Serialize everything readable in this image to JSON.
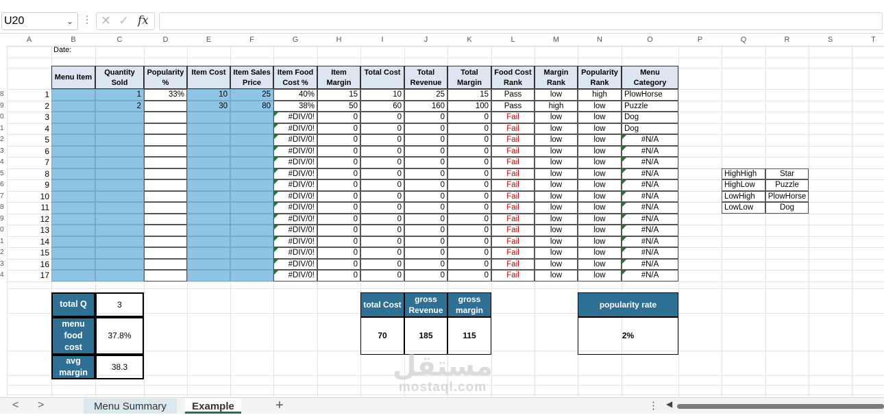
{
  "formula_bar": {
    "name_box": "U20",
    "icons": [
      "chevron-down-icon",
      "more-options-icon",
      "cancel-icon",
      "confirm-icon",
      "function-icon"
    ],
    "fx_label": "fx",
    "formula_value": ""
  },
  "columns": [
    "A",
    "B",
    "C",
    "D",
    "E",
    "F",
    "G",
    "H",
    "I",
    "J",
    "K",
    "L",
    "M",
    "N",
    "O",
    "P",
    "Q",
    "R",
    "S",
    "T"
  ],
  "headers": {
    "date": "Date:",
    "menu_item": "Menu Item",
    "quantity_sold": "Quantity Sold",
    "popularity": "Popularity %",
    "item_cost": "Item Cost",
    "item_sales_price": "Item Sales Price",
    "item_food_cost": "Item Food Cost %",
    "item_margin": "Item Margin",
    "total_cost": "Total Cost",
    "total_revenue": "Total Revenue",
    "total_margin": "Total Margin",
    "food_cost_rank": "Food Cost Rank",
    "margin_rank": "Margin Rank",
    "popularity_rank": "Popularity Rank",
    "menu_category": "Menu Category"
  },
  "rows": [
    {
      "n": "1",
      "qty": "1",
      "pop": "33%",
      "cost": "10",
      "price": "25",
      "fc": "40%",
      "margin": "15",
      "tcost": "10",
      "trev": "25",
      "tmargin": "15",
      "fcrank": "Pass",
      "mrank": "low",
      "prank": "high",
      "cat": "PlowHorse"
    },
    {
      "n": "2",
      "qty": "2",
      "pop": "",
      "cost": "30",
      "price": "80",
      "fc": "38%",
      "margin": "50",
      "tcost": "60",
      "trev": "160",
      "tmargin": "100",
      "fcrank": "Pass",
      "mrank": "high",
      "prank": "low",
      "cat": "Puzzle"
    },
    {
      "n": "3",
      "qty": "",
      "pop": "",
      "cost": "",
      "price": "",
      "fc": "#DIV/0!",
      "margin": "0",
      "tcost": "0",
      "trev": "0",
      "tmargin": "0",
      "fcrank": "Fail",
      "mrank": "low",
      "prank": "low",
      "cat": "Dog"
    },
    {
      "n": "4",
      "qty": "",
      "pop": "",
      "cost": "",
      "price": "",
      "fc": "#DIV/0!",
      "margin": "0",
      "tcost": "0",
      "trev": "0",
      "tmargin": "0",
      "fcrank": "Fail",
      "mrank": "low",
      "prank": "low",
      "cat": "Dog"
    },
    {
      "n": "5",
      "qty": "",
      "pop": "",
      "cost": "",
      "price": "",
      "fc": "#DIV/0!",
      "margin": "0",
      "tcost": "0",
      "trev": "0",
      "tmargin": "0",
      "fcrank": "Fail",
      "mrank": "low",
      "prank": "low",
      "cat": "#N/A"
    },
    {
      "n": "6",
      "qty": "",
      "pop": "",
      "cost": "",
      "price": "",
      "fc": "#DIV/0!",
      "margin": "0",
      "tcost": "0",
      "trev": "0",
      "tmargin": "0",
      "fcrank": "Fail",
      "mrank": "low",
      "prank": "low",
      "cat": "#N/A"
    },
    {
      "n": "7",
      "qty": "",
      "pop": "",
      "cost": "",
      "price": "",
      "fc": "#DIV/0!",
      "margin": "0",
      "tcost": "0",
      "trev": "0",
      "tmargin": "0",
      "fcrank": "Fail",
      "mrank": "low",
      "prank": "low",
      "cat": "#N/A"
    },
    {
      "n": "8",
      "qty": "",
      "pop": "",
      "cost": "",
      "price": "",
      "fc": "#DIV/0!",
      "margin": "0",
      "tcost": "0",
      "trev": "0",
      "tmargin": "0",
      "fcrank": "Fail",
      "mrank": "low",
      "prank": "low",
      "cat": "#N/A"
    },
    {
      "n": "9",
      "qty": "",
      "pop": "",
      "cost": "",
      "price": "",
      "fc": "#DIV/0!",
      "margin": "0",
      "tcost": "0",
      "trev": "0",
      "tmargin": "0",
      "fcrank": "Fail",
      "mrank": "low",
      "prank": "low",
      "cat": "#N/A"
    },
    {
      "n": "10",
      "qty": "",
      "pop": "",
      "cost": "",
      "price": "",
      "fc": "#DIV/0!",
      "margin": "0",
      "tcost": "0",
      "trev": "0",
      "tmargin": "0",
      "fcrank": "Fail",
      "mrank": "low",
      "prank": "low",
      "cat": "#N/A"
    },
    {
      "n": "11",
      "qty": "",
      "pop": "",
      "cost": "",
      "price": "",
      "fc": "#DIV/0!",
      "margin": "0",
      "tcost": "0",
      "trev": "0",
      "tmargin": "0",
      "fcrank": "Fail",
      "mrank": "low",
      "prank": "low",
      "cat": "#N/A"
    },
    {
      "n": "12",
      "qty": "",
      "pop": "",
      "cost": "",
      "price": "",
      "fc": "#DIV/0!",
      "margin": "0",
      "tcost": "0",
      "trev": "0",
      "tmargin": "0",
      "fcrank": "Fail",
      "mrank": "low",
      "prank": "low",
      "cat": "#N/A"
    },
    {
      "n": "13",
      "qty": "",
      "pop": "",
      "cost": "",
      "price": "",
      "fc": "#DIV/0!",
      "margin": "0",
      "tcost": "0",
      "trev": "0",
      "tmargin": "0",
      "fcrank": "Fail",
      "mrank": "low",
      "prank": "low",
      "cat": "#N/A"
    },
    {
      "n": "14",
      "qty": "",
      "pop": "",
      "cost": "",
      "price": "",
      "fc": "#DIV/0!",
      "margin": "0",
      "tcost": "0",
      "trev": "0",
      "tmargin": "0",
      "fcrank": "Fail",
      "mrank": "low",
      "prank": "low",
      "cat": "#N/A"
    },
    {
      "n": "15",
      "qty": "",
      "pop": "",
      "cost": "",
      "price": "",
      "fc": "#DIV/0!",
      "margin": "0",
      "tcost": "0",
      "trev": "0",
      "tmargin": "0",
      "fcrank": "Fail",
      "mrank": "low",
      "prank": "low",
      "cat": "#N/A"
    },
    {
      "n": "16",
      "qty": "",
      "pop": "",
      "cost": "",
      "price": "",
      "fc": "#DIV/0!",
      "margin": "0",
      "tcost": "0",
      "trev": "0",
      "tmargin": "0",
      "fcrank": "Fail",
      "mrank": "low",
      "prank": "low",
      "cat": "#N/A"
    },
    {
      "n": "17",
      "qty": "",
      "pop": "",
      "cost": "",
      "price": "",
      "fc": "#DIV/0!",
      "margin": "0",
      "tcost": "0",
      "trev": "0",
      "tmargin": "0",
      "fcrank": "Fail",
      "mrank": "low",
      "prank": "low",
      "cat": "#N/A"
    }
  ],
  "category_lookup": [
    {
      "key": "HighHigh",
      "value": "Star"
    },
    {
      "key": "HighLow",
      "value": "Puzzle"
    },
    {
      "key": "LowHigh",
      "value": "PlowHorse"
    },
    {
      "key": "LowLow",
      "value": "Dog"
    }
  ],
  "summary_left": {
    "total_q_label": "total Q",
    "total_q_value": "3",
    "food_cost_label": "menu food cost",
    "food_cost_value": "37.8%",
    "avg_margin_label": "avg margin",
    "avg_margin_value": "38.3"
  },
  "summary_totals": {
    "total_cost_label": "total Cost",
    "total_cost_value": "70",
    "gross_revenue_label": "gross Revenue",
    "gross_revenue_value": "185",
    "gross_margin_label": "gross margin",
    "gross_margin_value": "115"
  },
  "popularity_rate": {
    "label": "popularity rate",
    "value": "2%"
  },
  "watermark": {
    "arabic": "مستقل",
    "latin": "mostaql.com"
  },
  "tabs": {
    "prev": "<",
    "next": ">",
    "sheets": [
      "Menu Summary",
      "Example"
    ],
    "active": "Example",
    "add": "+",
    "more": "⋮"
  },
  "colors": {
    "header_fill": "#dce6f1",
    "input_fill": "#8ec5e6",
    "dark_fill": "#2f6f93",
    "fail_red": "#c00000",
    "error_green": "#1e7b34",
    "active_tab_accent": "#217346"
  }
}
